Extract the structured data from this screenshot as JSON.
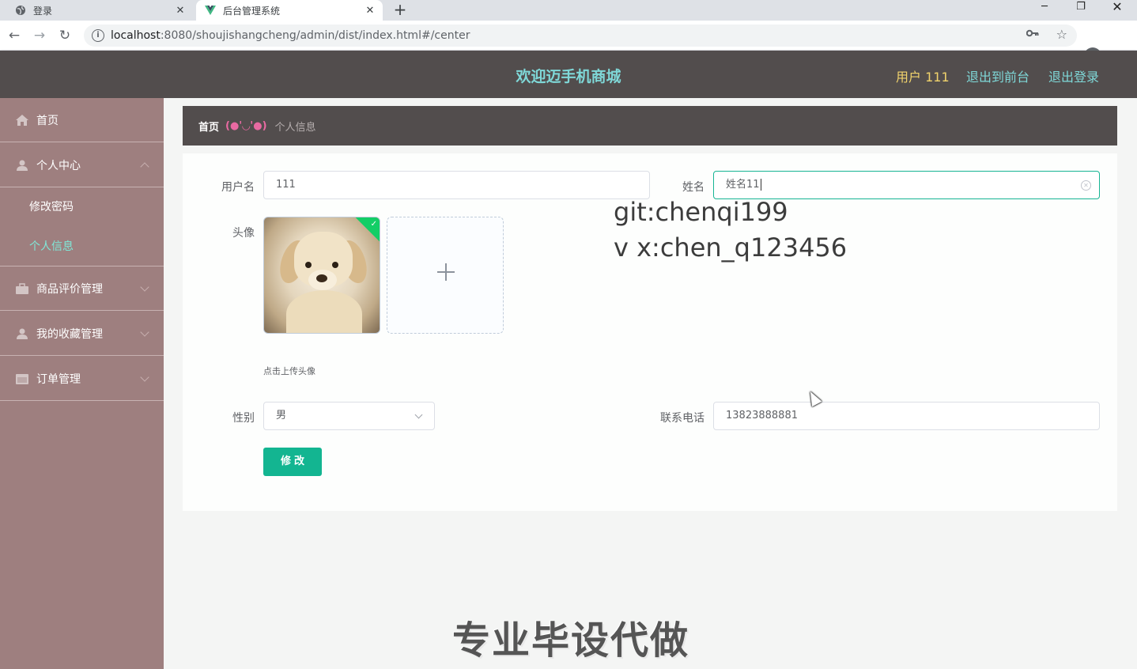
{
  "browser": {
    "tabs": [
      {
        "title": "登录",
        "close": "✕"
      },
      {
        "title": "后台管理系统",
        "close": "✕"
      }
    ],
    "new_tab": "+",
    "window_controls": {
      "minimize": "─",
      "restore": "❐",
      "close": "✕"
    },
    "url_host": "localhost",
    "url_path": ":8080/shoujishangcheng/admin/dist/index.html#/center",
    "nav": {
      "back": "←",
      "forward": "→",
      "reload": "↻"
    }
  },
  "header": {
    "title": "欢迎迈手机商城",
    "user_label": "用户 111",
    "front_link": "退出到前台",
    "logout_link": "退出登录",
    "colors": {
      "bg": "#524d4d",
      "title": "#7fd8d8",
      "user": "#f1d36c"
    }
  },
  "sidebar": {
    "items": [
      {
        "label": "首页",
        "icon": "home-icon"
      },
      {
        "label": "个人中心",
        "icon": "user-icon",
        "expanded": true,
        "children": [
          {
            "label": "修改密码",
            "active": false
          },
          {
            "label": "个人信息",
            "active": true
          }
        ]
      },
      {
        "label": "商品评价管理",
        "icon": "briefcase-icon"
      },
      {
        "label": "我的收藏管理",
        "icon": "user-icon"
      },
      {
        "label": "订单管理",
        "icon": "calendar-icon"
      }
    ],
    "colors": {
      "bg": "#9e7f7f",
      "active": "#7fe8d8"
    }
  },
  "breadcrumb": {
    "home": "首页",
    "separator": "(●'◡'●)",
    "current": "个人信息"
  },
  "form": {
    "username_label": "用户名",
    "username_value": "111",
    "name_label": "姓名",
    "name_value": "姓名11",
    "avatar_label": "头像",
    "upload_tip": "点击上传头像",
    "gender_label": "性别",
    "gender_value": "男",
    "phone_label": "联系电话",
    "phone_value": "13823888881",
    "submit_label": "修改",
    "colors": {
      "accent": "#13b591",
      "focus_border": "#17b594"
    }
  },
  "overlay": {
    "watermark_line1": "git:chenqi199",
    "watermark_line2": "v x:chen_q123456",
    "banner": "专业毕设代做"
  }
}
